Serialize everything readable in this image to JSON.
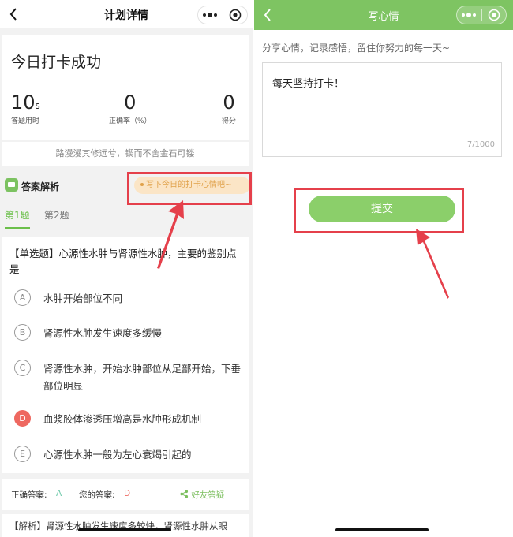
{
  "left": {
    "nav": {
      "title": "计划详情"
    },
    "result": {
      "title": "今日打卡成功",
      "stats": [
        {
          "value": "10",
          "unit": "s",
          "label": "答题用时"
        },
        {
          "value": "0",
          "unit": "",
          "label": "正确率（%）"
        },
        {
          "value": "0",
          "unit": "",
          "label": "得分"
        }
      ],
      "motto": "路漫漫其修远兮，锲而不舍金石可镂"
    },
    "answer_header": {
      "title": "答案解析",
      "mood_button": "写下今日的打卡心情吧~"
    },
    "tabs": [
      {
        "label": "第1题"
      },
      {
        "label": "第2题"
      }
    ],
    "question": {
      "text": "【单选题】心源性水肿与肾源性水肿，主要的鉴别点是",
      "options": [
        {
          "letter": "A",
          "text": "水肿开始部位不同"
        },
        {
          "letter": "B",
          "text": "肾源性水肿发生速度多缓慢"
        },
        {
          "letter": "C",
          "text": "肾源性水肿，开始水肿部位从足部开始，下垂部位明显"
        },
        {
          "letter": "D",
          "text": "血浆胶体渗透压增高是水肿形成机制"
        },
        {
          "letter": "E",
          "text": "心源性水肿一般为左心衰竭引起的"
        }
      ]
    },
    "answers": {
      "correct_label": "正确答案:",
      "correct_value": "A",
      "yours_label": "您的答案:",
      "yours_value": "D",
      "share_label": "好友答疑"
    },
    "analysis": "【解析】肾源性水肿发生速度多较快，肾源性水肿从眼"
  },
  "right": {
    "nav": {
      "title": "写心情"
    },
    "subtitle": "分享心情，记录感悟，留住你努力的每一天~",
    "textarea": {
      "value": "每天坚持打卡！",
      "count": "7/1000"
    },
    "submit_label": "提交"
  },
  "colors": {
    "accent": "#7ec462",
    "annotation": "#e5404b",
    "wrong": "#ee6860",
    "mood_bg": "#fbe5c6",
    "mood_text": "#e0a14a"
  }
}
